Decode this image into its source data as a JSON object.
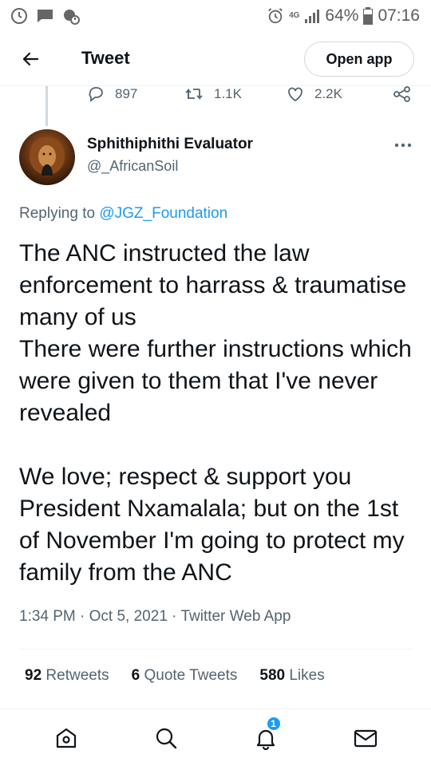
{
  "status_bar": {
    "network": "4G",
    "battery": "64%",
    "time": "07:16"
  },
  "header": {
    "title": "Tweet",
    "open_app_label": "Open app"
  },
  "parent_actions": {
    "replies": "897",
    "retweets": "1.1K",
    "likes": "2.2K"
  },
  "tweet": {
    "author_name": "Sphithiphithi Evaluator",
    "author_handle": "@_AfricanSoil",
    "replying_prefix": "Replying to",
    "replying_to": "@JGZ_Foundation",
    "text_para1": "The ANC instructed the law enforcement to harrass & traumatise many of us\nThere were further instructions which were given to them that I've never revealed",
    "text_para2": "We love; respect & support you President Nxamalala; but on the 1st of November I'm going to protect my family from the ANC",
    "time": "1:34 PM",
    "date": "Oct 5, 2021",
    "source": "Twitter Web App",
    "separator": "·"
  },
  "stats": {
    "retweets_count": "92",
    "retweets_label": "Retweets",
    "quotes_count": "6",
    "quotes_label": "Quote Tweets",
    "likes_count": "580",
    "likes_label": "Likes"
  },
  "bottom_nav": {
    "notifications_badge": "1"
  },
  "colors": {
    "accent": "#1d9bf0",
    "text_primary": "#0f1419",
    "text_secondary": "#536471",
    "border": "#eff3f4"
  },
  "icons": {
    "back": "arrow-left-icon",
    "more": "more-dots-icon",
    "reply": "reply-icon",
    "retweet": "retweet-icon",
    "like": "heart-icon",
    "share": "share-icon",
    "home": "home-icon",
    "search": "search-icon",
    "notifications": "bell-icon",
    "messages": "mail-icon"
  }
}
